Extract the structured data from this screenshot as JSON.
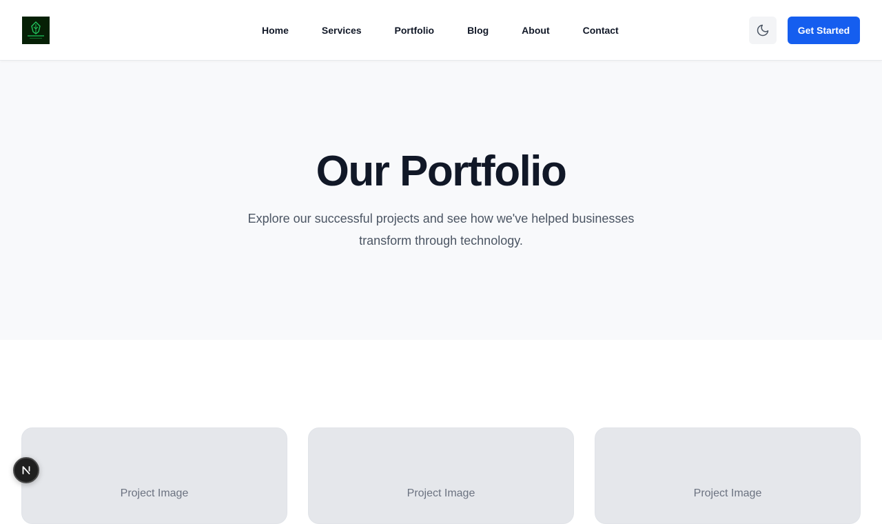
{
  "brand": {
    "logo_icon": "leaf-logo-icon",
    "logo_bg": "#062006",
    "logo_accent": "#22c55e"
  },
  "nav": {
    "items": [
      {
        "label": "Home"
      },
      {
        "label": "Services"
      },
      {
        "label": "Portfolio"
      },
      {
        "label": "Blog"
      },
      {
        "label": "About"
      },
      {
        "label": "Contact"
      }
    ]
  },
  "header": {
    "theme_toggle_icon": "moon-icon",
    "cta_label": "Get Started",
    "cta_color": "#155eef"
  },
  "hero": {
    "title": "Our Portfolio",
    "subtitle": "Explore our successful projects and see how we've helped businesses transform through technology."
  },
  "projects": [
    {
      "image_label": "Project Image"
    },
    {
      "image_label": "Project Image"
    },
    {
      "image_label": "Project Image"
    }
  ],
  "dev_badge": {
    "icon": "nextjs-n-icon"
  }
}
